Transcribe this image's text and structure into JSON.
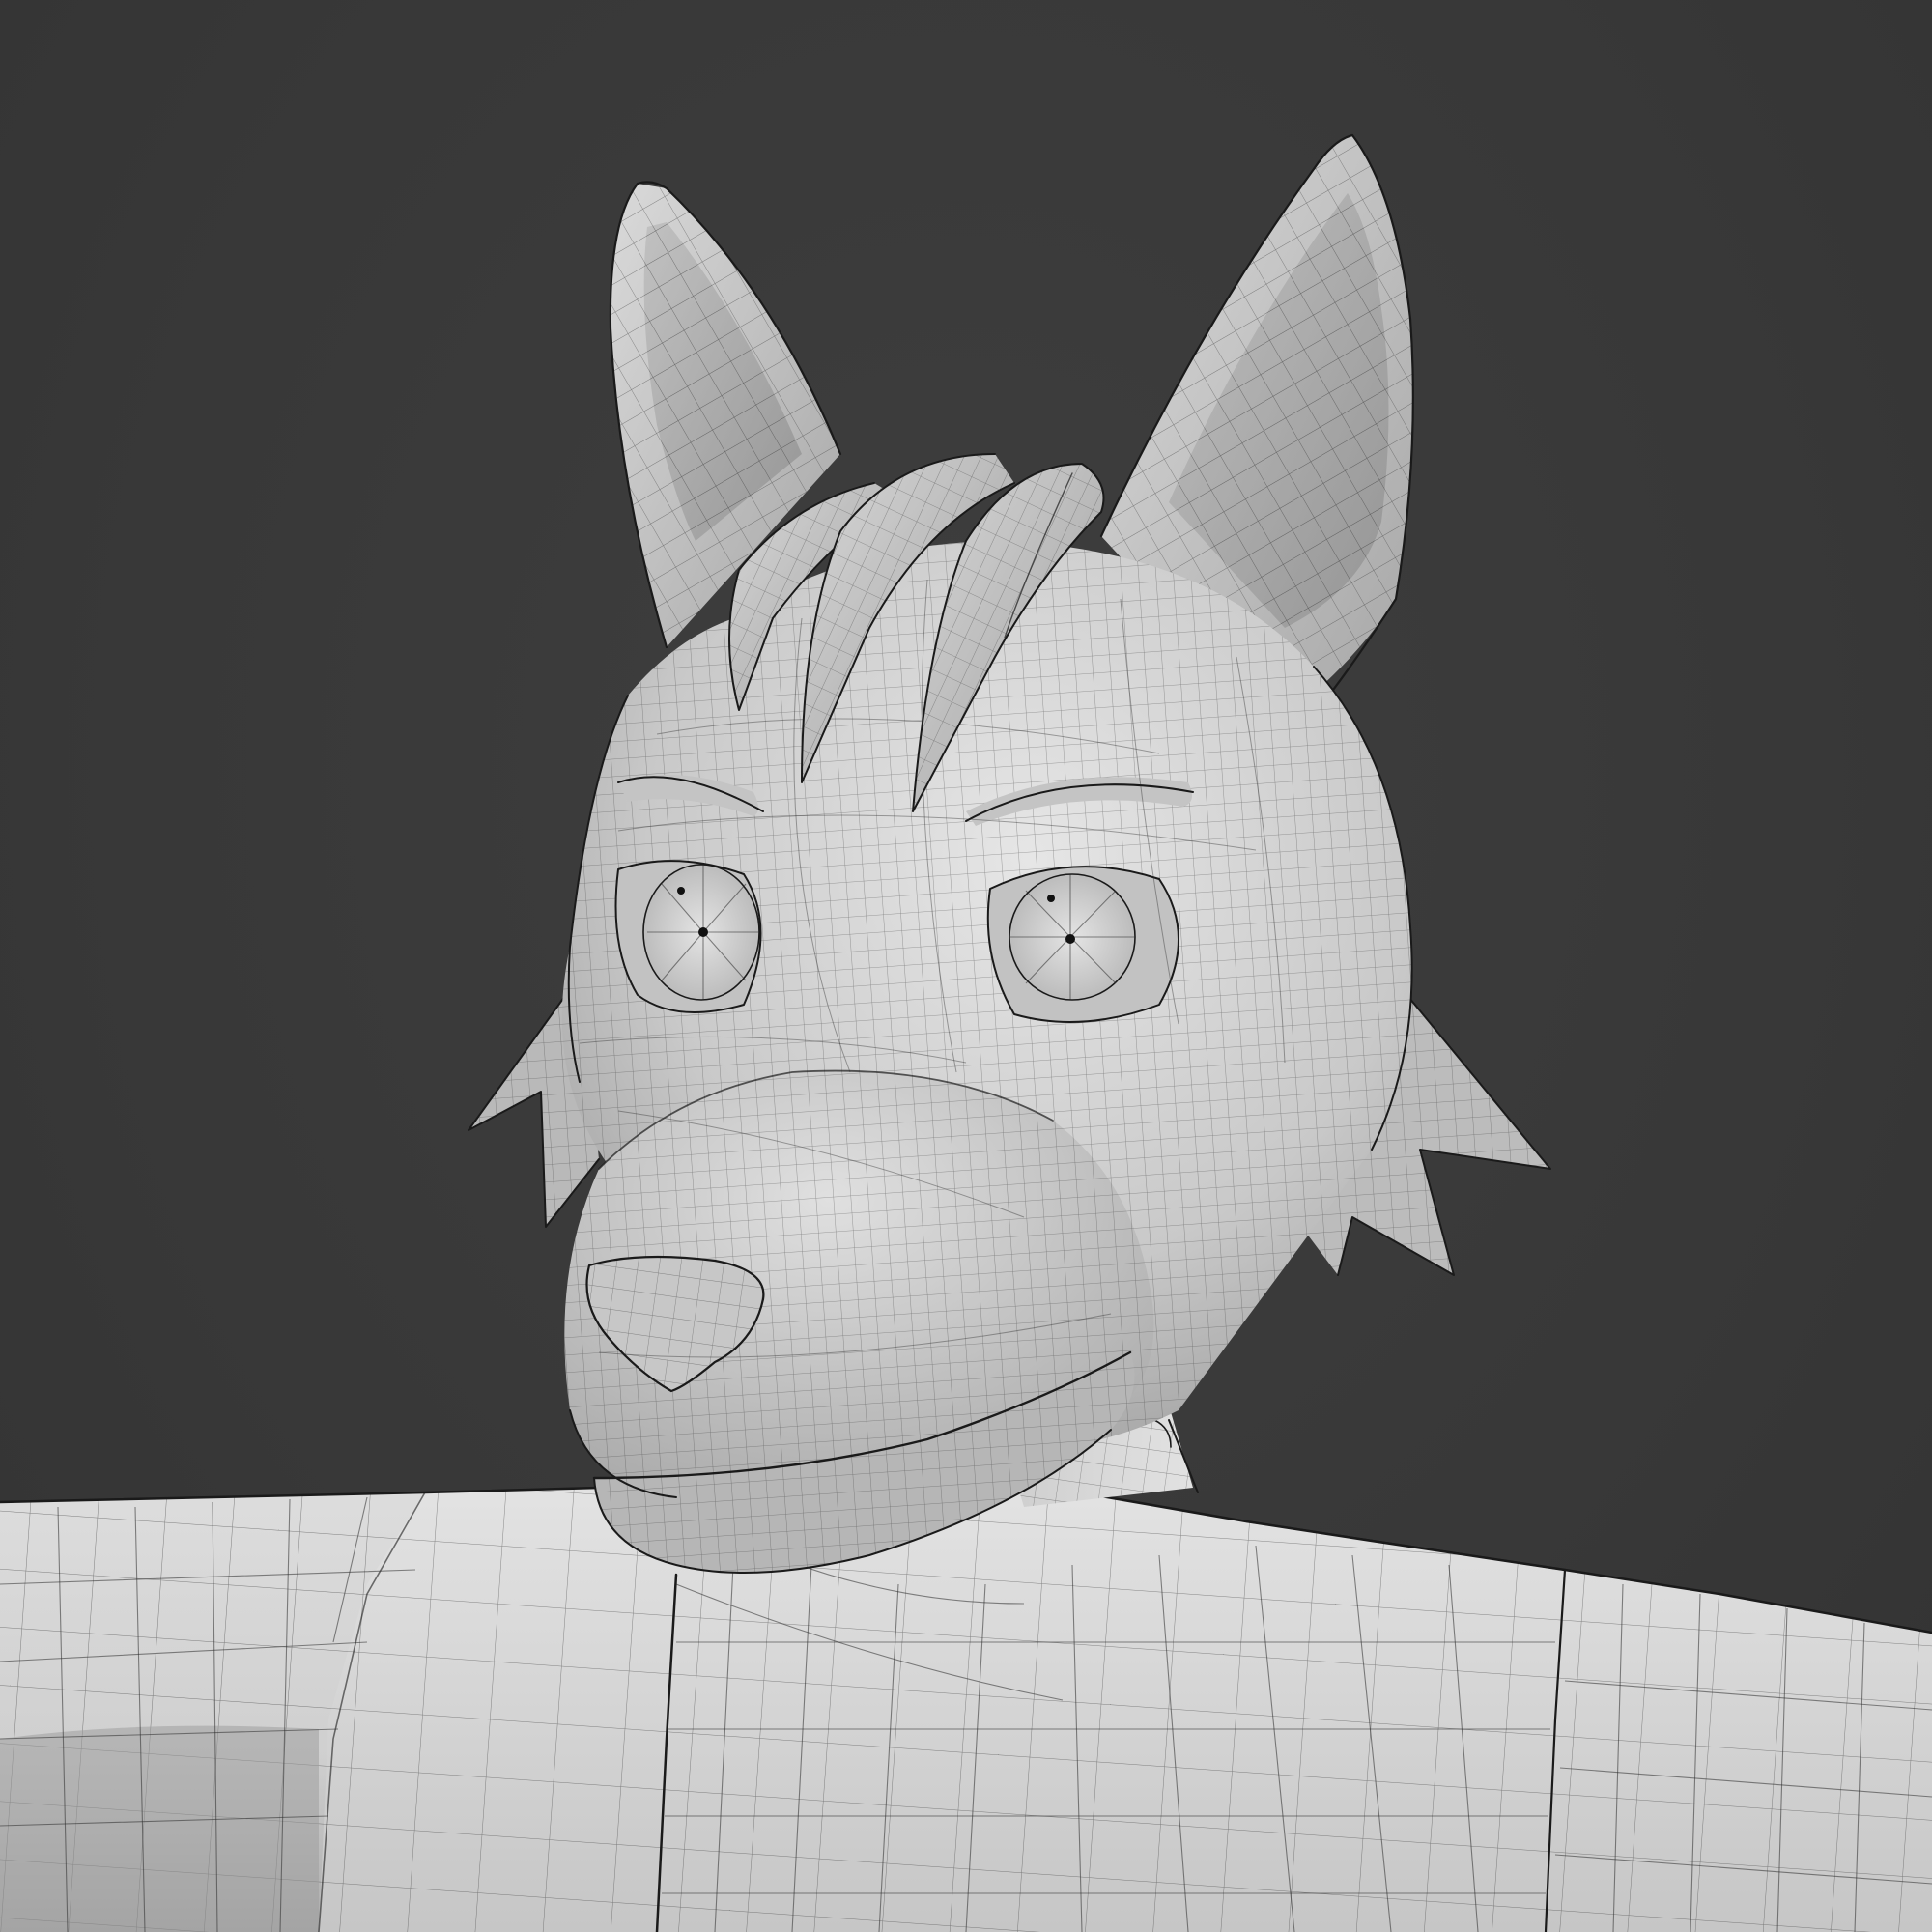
{
  "scene": {
    "view": "3d-viewport",
    "shading": "solid-wireframe-overlay",
    "subject": "stylized-wolf-character-head-and-torso"
  },
  "colors": {
    "background": "#383838",
    "mesh_light": "#d9d9d9",
    "mesh_mid": "#b3b3b3",
    "mesh_shadow": "#8c8c8c",
    "wire": "#2b2b2b",
    "outline": "#1a1a1a"
  }
}
